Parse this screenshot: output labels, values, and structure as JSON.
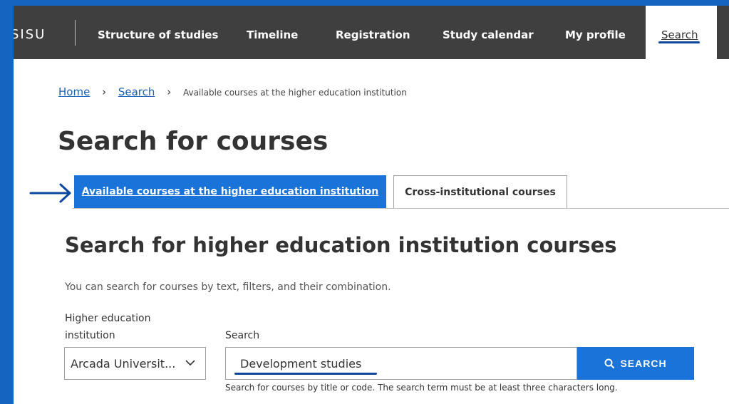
{
  "nav": {
    "logo": "SISU",
    "items": [
      "Structure of studies",
      "Timeline",
      "Registration",
      "Study calendar",
      "My profile"
    ],
    "active": "Search"
  },
  "breadcrumb": {
    "home": "Home",
    "search": "Search",
    "current": "Available courses at the higher education institution"
  },
  "page_title": "Search for courses",
  "tabs": {
    "active": "Available courses at the higher education institution",
    "inactive": "Cross-institutional courses"
  },
  "section": {
    "title": "Search for higher education institution courses",
    "help": "You can search for courses by text, filters, and their combination.",
    "institution_label": "Higher education institution",
    "institution_value": "Arcada Universit...",
    "search_label": "Search",
    "search_value": "Development studies",
    "search_button": "SEARCH",
    "hint": "Search for courses by title or code. The search term must be at least three characters long."
  },
  "colors": {
    "accent": "#1a73d9",
    "nav_bg": "#3f3f3f",
    "frame_border": "#1565c0",
    "annotation": "#0d47a1"
  }
}
